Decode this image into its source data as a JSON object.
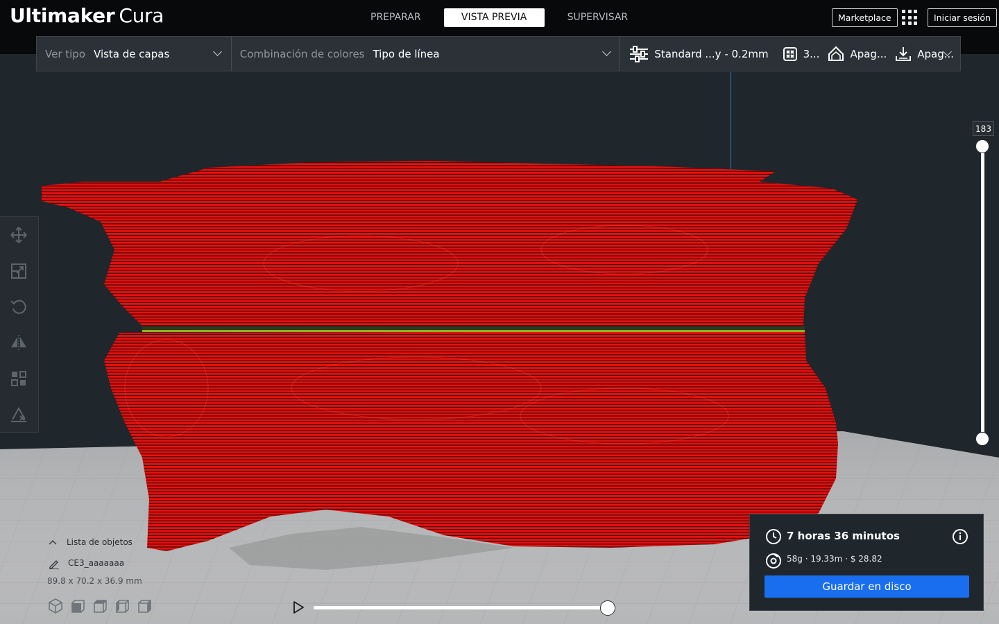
{
  "app": {
    "name_bold": "Ultimaker",
    "name_light": "Cura"
  },
  "stages": [
    {
      "label": "PREPARAR"
    },
    {
      "label": "VISTA PREVIA",
      "active": true
    },
    {
      "label": "SUPERVISAR"
    }
  ],
  "header": {
    "marketplace": "Marketplace",
    "login": "Iniciar sesión"
  },
  "toolbar": {
    "view_type_label": "Ver tipo",
    "view_type_value": "Vista de capas",
    "color_scheme_label": "Combinación de colores",
    "color_scheme_value": "Tipo de línea",
    "profile": "Standard ...y - 0.2mm",
    "infill": "3...",
    "support": "Apag...",
    "adhesion": "Apag..."
  },
  "layer_slider": {
    "current_layer": "183",
    "upper_fraction": 1.0,
    "lower_fraction": 0.0
  },
  "simulation": {
    "progress_fraction": 1.0
  },
  "objects": {
    "title": "Lista de objetos",
    "name": "CE3_aaaaaaa",
    "dimensions": "89.8 x 70.2 x 36.9 mm"
  },
  "output": {
    "print_time": "7 horas 36 minutos",
    "material": "58g · 19.33m · $ 28.82",
    "save_button": "Guardar en disco"
  },
  "colors": {
    "model_red": "#e4110f",
    "accent_blue": "#196ef0",
    "header_bg": "#08090b",
    "panel_bg": "#2b3137"
  }
}
